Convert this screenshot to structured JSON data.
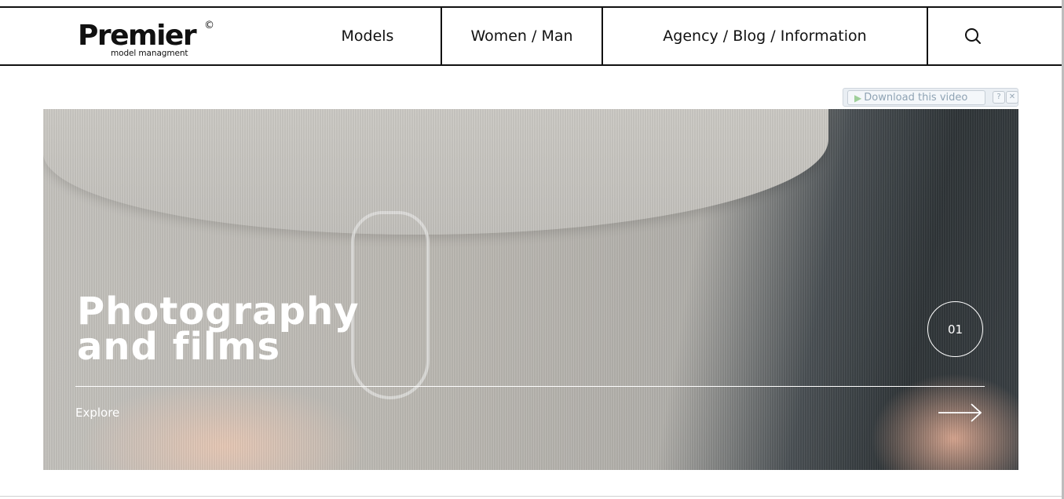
{
  "header": {
    "logo": {
      "word": "Premier",
      "mark": "©",
      "tagline": "model managment"
    },
    "nav": {
      "models": "Models",
      "gender": "Women / Man",
      "agency": "Agency / Blog / Information"
    },
    "search_icon": "search-icon"
  },
  "download_bar": {
    "label": "Download this video",
    "help": "?",
    "close": "✕",
    "play_icon": "play-icon"
  },
  "hero": {
    "title_line1": "Photography",
    "title_line2": "and films",
    "slide_number": "01",
    "explore": "Explore",
    "arrow_icon": "arrow-right-icon"
  },
  "colors": {
    "text": "#111111",
    "hero_text": "#ffffff",
    "download_text": "#8fa3b4"
  }
}
